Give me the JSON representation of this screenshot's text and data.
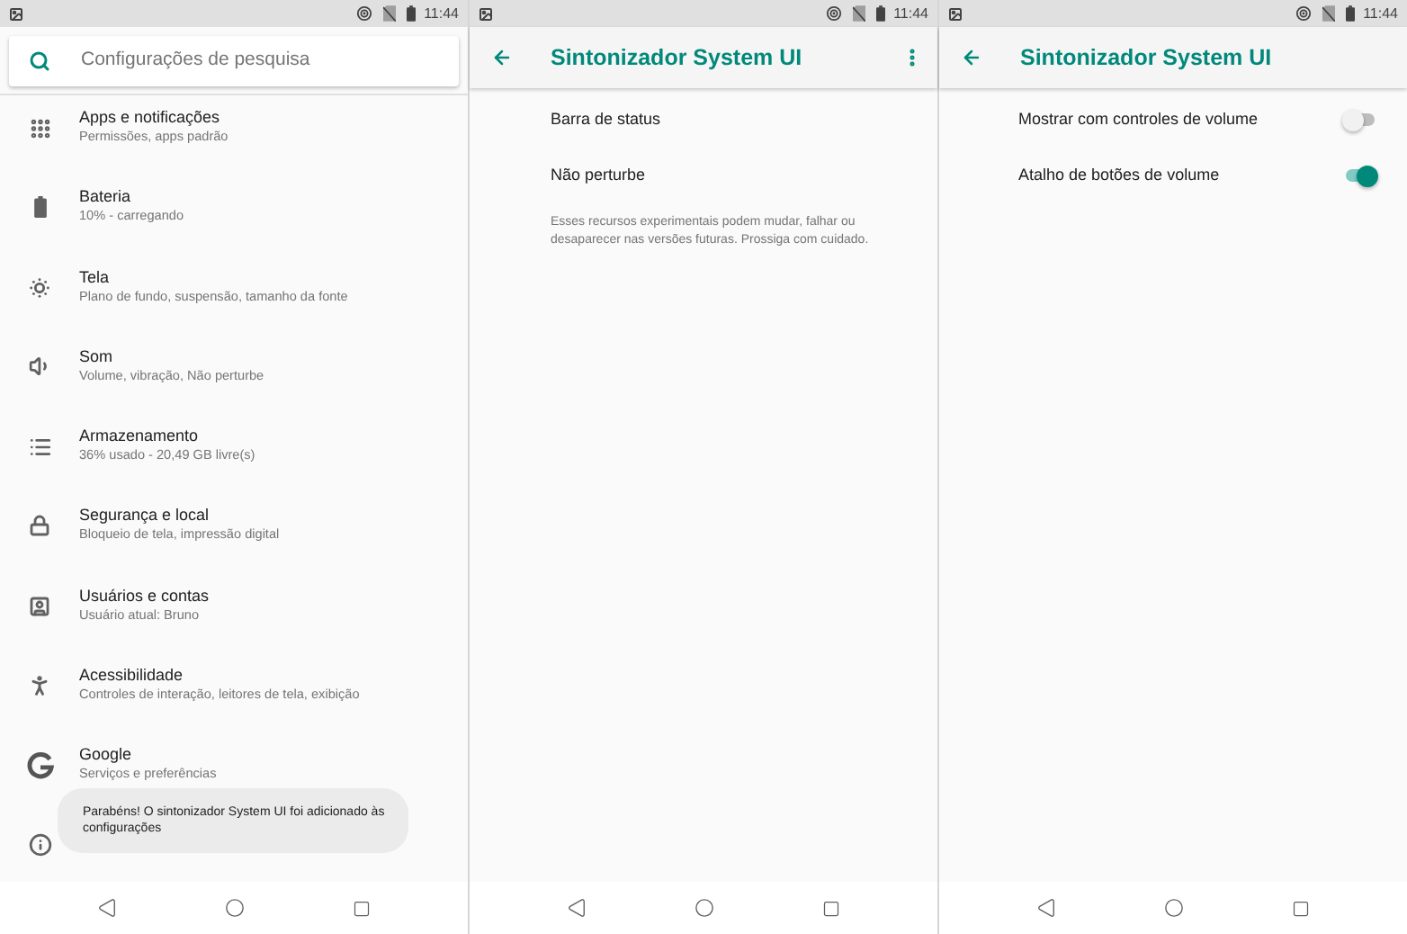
{
  "settings_screen": {
    "status_bar": {
      "time": "11:44"
    },
    "search": {
      "placeholder": "Configurações de pesquisa"
    },
    "items": [
      {
        "title": "Apps e notificações",
        "subtitle": "Permissões, apps padrão"
      },
      {
        "title": "Bateria",
        "subtitle": "10% - carregando"
      },
      {
        "title": "Tela",
        "subtitle": "Plano de fundo, suspensão, tamanho da fonte"
      },
      {
        "title": "Som",
        "subtitle": "Volume, vibração, Não perturbe"
      },
      {
        "title": "Armazenamento",
        "subtitle": "36% usado - 20,49 GB livre(s)"
      },
      {
        "title": "Segurança e local",
        "subtitle": "Bloqueio de tela, impressão digital"
      },
      {
        "title": "Usuários e contas",
        "subtitle": "Usuário atual: Bruno"
      },
      {
        "title": "Acessibilidade",
        "subtitle": "Controles de interação, leitores de tela, exibição"
      },
      {
        "title": "Google",
        "subtitle": "Serviços e preferências"
      }
    ],
    "toast": "Parabéns! O sintonizador System UI foi adicionado às configurações"
  },
  "tuner_screen": {
    "status_bar": {
      "time": "11:44"
    },
    "title": "Sintonizador System UI",
    "items": [
      {
        "label": "Barra de status"
      },
      {
        "label": "Não perturbe"
      }
    ],
    "note": "Esses recursos experimentais podem mudar, falhar ou desaparecer nas versões futuras. Prossiga com cuidado."
  },
  "volume_screen": {
    "status_bar": {
      "time": "11:44"
    },
    "title": "Sintonizador System UI",
    "items": [
      {
        "label": "Mostrar com controles de volume",
        "on": false
      },
      {
        "label": "Atalho de botões de volume",
        "on": true
      }
    ]
  }
}
